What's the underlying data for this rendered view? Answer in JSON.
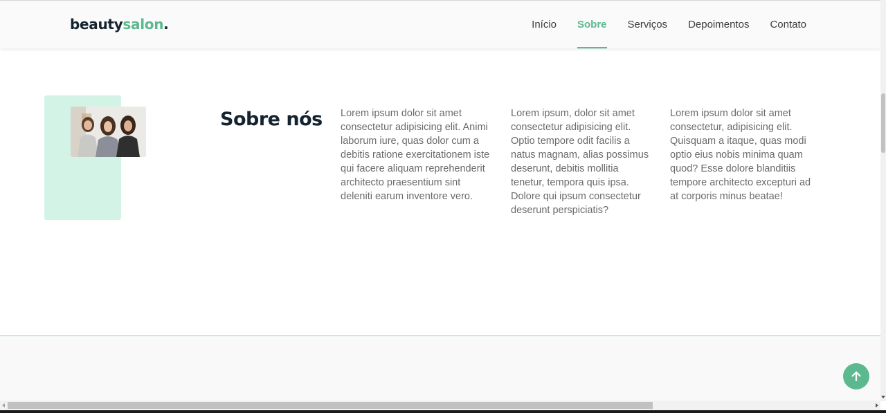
{
  "header": {
    "logo_main": "beauty",
    "logo_accent": "salon",
    "logo_dot": ".",
    "nav": [
      {
        "label": "Início",
        "active": false
      },
      {
        "label": "Sobre",
        "active": true
      },
      {
        "label": "Serviços",
        "active": false
      },
      {
        "label": "Depoimentos",
        "active": false
      },
      {
        "label": "Contato",
        "active": false
      }
    ]
  },
  "about": {
    "title": "Sobre nós",
    "photo": "three-women-portrait",
    "paragraphs": [
      "Lorem ipsum dolor sit amet consectetur adipisicing elit. Animi laborum iure, quas dolor cum a debitis ratione exercitationem iste qui facere aliquam reprehenderit architecto praesentium sint deleniti earum inventore vero.",
      "Lorem ipsum, dolor sit amet consectetur adipisicing elit. Optio tempore odit facilis a natus magnam, alias possimus deserunt, debitis mollitia tenetur, tempora quis ipsa. Dolore qui ipsum consectetur deserunt perspiciatis?",
      "Lorem ipsum dolor sit amet consectetur, adipisicing elit. Quisquam a itaque, quas modi optio eius nobis minima quam quod? Esse dolore blanditiis tempore architecto excepturi ad at corporis minus beatae!"
    ]
  },
  "back_to_top": {
    "icon": "arrow-up-icon"
  },
  "colors": {
    "accent": "#5cb88e",
    "mint": "#d3f3e6",
    "dark": "#13232f"
  }
}
